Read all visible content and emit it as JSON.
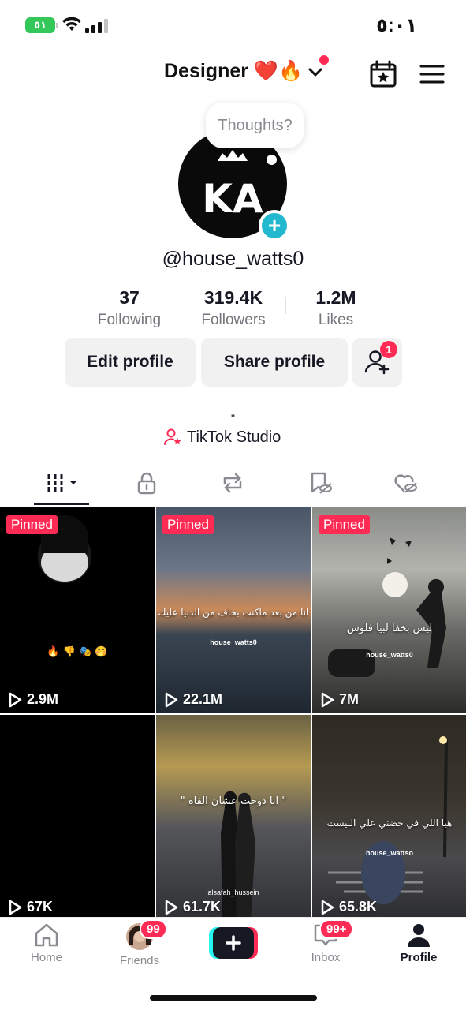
{
  "status": {
    "battery": "٥١",
    "time": "٥:٠١"
  },
  "header": {
    "title": "Designer ❤️🔥"
  },
  "profile": {
    "thought_bubble": "Thoughts?",
    "username": "@house_watts0",
    "avatar_monogram": "KA",
    "stats": [
      {
        "value": "37",
        "label": "Following"
      },
      {
        "value": "319.4K",
        "label": "Followers"
      },
      {
        "value": "1.2M",
        "label": "Likes"
      }
    ],
    "edit_label": "Edit profile",
    "share_label": "Share profile",
    "friend_requests": "1",
    "bio": "\"",
    "studio_label": "TikTok Studio"
  },
  "tabs": [
    "videos-grid",
    "private-lock",
    "reposts",
    "favorites",
    "liked"
  ],
  "videos": [
    {
      "pinned": "Pinned",
      "views": "2.9M",
      "caption": "🔥 👎 🎭 🤭"
    },
    {
      "pinned": "Pinned",
      "views": "22.1M",
      "caption": "انا من بعد ماكنت بخاف من الدنيا عليك",
      "watermark": "house_watts0"
    },
    {
      "pinned": "Pinned",
      "views": "7M",
      "caption": "ليس بخفا لبيا فلوس",
      "watermark": "house_watts0"
    },
    {
      "views": "67K"
    },
    {
      "views": "61.7K",
      "caption": "\" انا دوخت عشان القاه \"",
      "watermark": "alsafah_hussein"
    },
    {
      "views": "65.8K",
      "caption": "هيا اللي في حضني علي البيست",
      "watermark": "house_wattso"
    }
  ],
  "nav": {
    "home": "Home",
    "friends": "Friends",
    "friends_badge": "99",
    "inbox": "Inbox",
    "inbox_badge": "99+",
    "profile": "Profile"
  },
  "colors": {
    "accent": "#fe2c55",
    "cyan": "#22b8cf",
    "text": "#161823",
    "muted": "#75767c"
  }
}
